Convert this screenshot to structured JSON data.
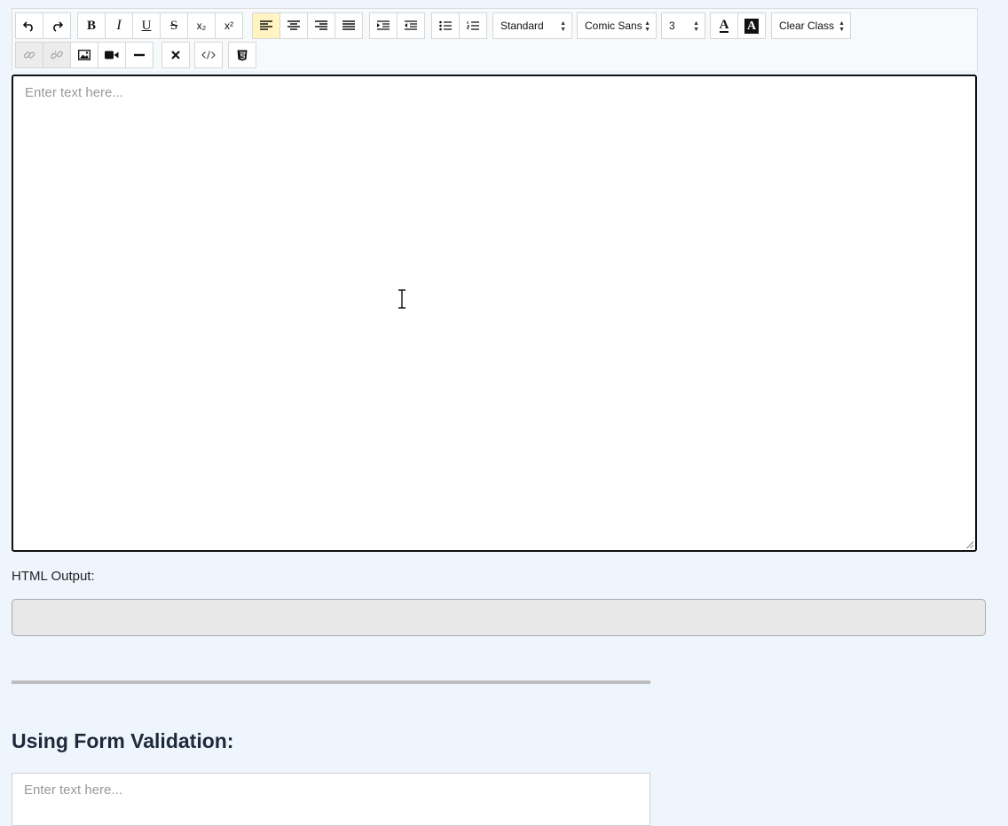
{
  "toolbar": {
    "history": [
      {
        "name": "undo-button",
        "glyph": "↶"
      },
      {
        "name": "redo-button",
        "glyph": "↷"
      }
    ],
    "format": [
      {
        "name": "bold-button",
        "glyph": "B"
      },
      {
        "name": "italic-button",
        "glyph": "I"
      },
      {
        "name": "underline-button",
        "glyph": "U"
      },
      {
        "name": "strikethrough-button",
        "glyph": "S"
      },
      {
        "name": "subscript-button",
        "glyph": "x₂"
      },
      {
        "name": "superscript-button",
        "glyph": "x²"
      }
    ],
    "align": [
      {
        "name": "align-left-button",
        "glyph": "≡",
        "active": true
      },
      {
        "name": "align-center-button",
        "glyph": "≡"
      },
      {
        "name": "align-right-button",
        "glyph": "≡"
      },
      {
        "name": "align-justify-button",
        "glyph": "≡"
      }
    ],
    "indent": [
      {
        "name": "indent-button",
        "glyph": "⇥"
      },
      {
        "name": "outdent-button",
        "glyph": "⇤"
      }
    ],
    "lists": [
      {
        "name": "bullet-list-button",
        "glyph": "☰"
      },
      {
        "name": "numbered-list-button",
        "glyph": "☷"
      }
    ],
    "paragraph_select": "Standard",
    "font_select": "Comic Sans",
    "size_select": "3",
    "text_color_glyph": "A",
    "bg_color_glyph": "A",
    "class_select": "Clear Class",
    "row2": [
      {
        "name": "link-button",
        "glyph": "🔗",
        "disabled": true
      },
      {
        "name": "unlink-button",
        "glyph": "⛓",
        "disabled": true
      },
      {
        "name": "image-button",
        "glyph": "▣"
      },
      {
        "name": "video-button",
        "glyph": "■"
      },
      {
        "name": "horizontal-rule-button",
        "glyph": "—"
      }
    ],
    "remove_format_glyph": "✕",
    "source_glyph": "</>",
    "html5_glyph": "5"
  },
  "editor": {
    "placeholder": "Enter text here..."
  },
  "output": {
    "label": "HTML Output:"
  },
  "section": {
    "title": "Using Form Validation:"
  },
  "editor2": {
    "placeholder": "Enter text here..."
  }
}
